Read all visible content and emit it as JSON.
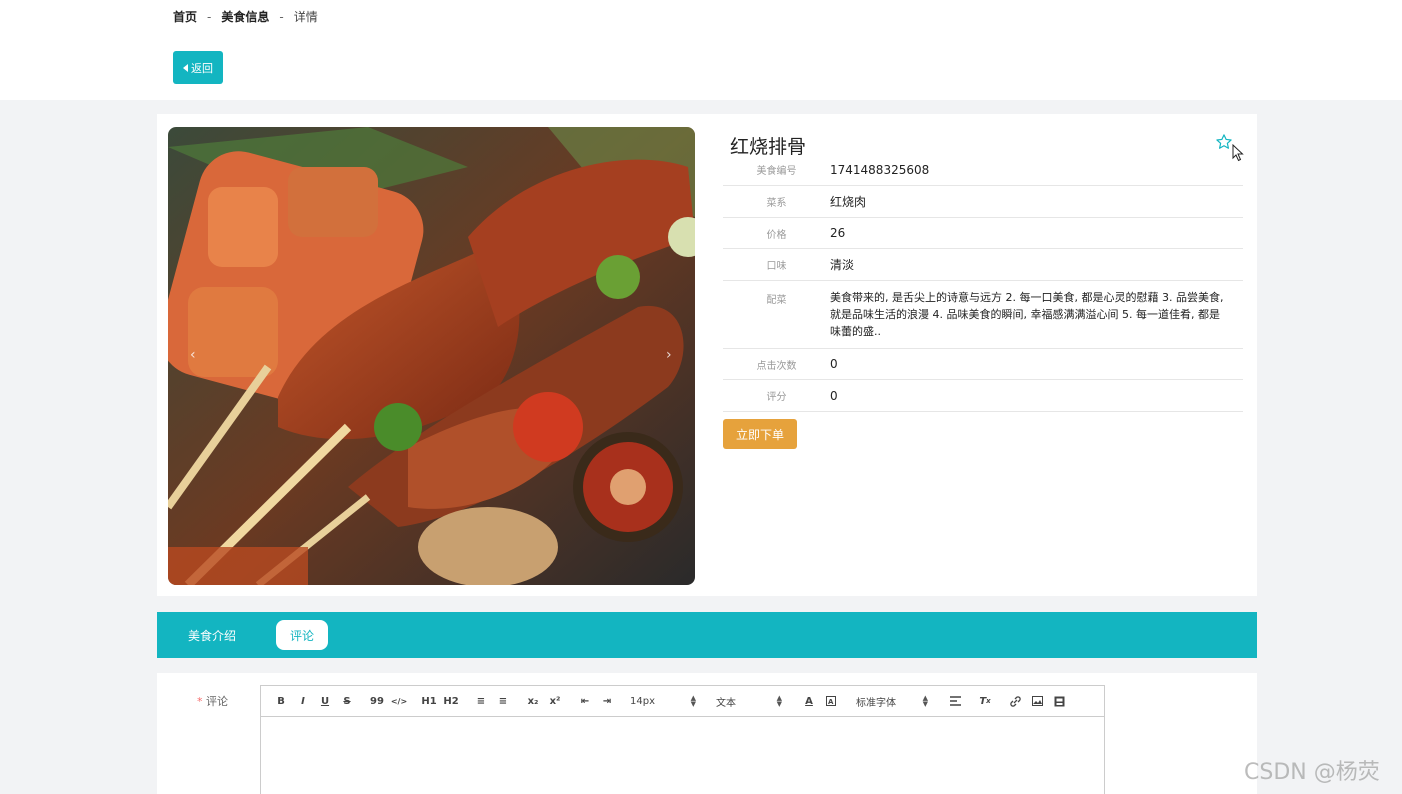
{
  "breadcrumb": {
    "home": "首页",
    "section": "美食信息",
    "current": "详情",
    "separator": "-"
  },
  "back_button": {
    "label": "返回",
    "icon": "caret-left-icon"
  },
  "detail": {
    "title": "红烧排骨",
    "favorite_icon": "star-outline-icon",
    "fields": [
      {
        "label": "美食编号",
        "value": "1741488325608"
      },
      {
        "label": "菜系",
        "value": "红烧肉"
      },
      {
        "label": "价格",
        "value": "26"
      },
      {
        "label": "口味",
        "value": "清淡"
      },
      {
        "label": "配菜",
        "value": "美食带来的, 是舌尖上的诗意与远方 2. 每一口美食, 都是心灵的慰藉 3. 品尝美食, 就是品味生活的浪漫 4. 品味美食的瞬间, 幸福感满满溢心间 5. 每一道佳肴, 都是味蕾的盛.."
      },
      {
        "label": "点击次数",
        "value": "0"
      },
      {
        "label": "评分",
        "value": "0"
      }
    ],
    "order_button": "立即下单",
    "carousel": {
      "prev": "‹",
      "next": "›"
    }
  },
  "tabs": [
    {
      "label": "美食介绍",
      "active": false
    },
    {
      "label": "评论",
      "active": true
    }
  ],
  "comment": {
    "required_mark": "*",
    "label": "评论",
    "toolbar": {
      "buttons": [
        "B",
        "I",
        "U",
        "S",
        "99",
        "</>",
        "H1",
        "H2",
        "≡",
        "≡",
        "x₂",
        "x²",
        "⇤",
        "⇥"
      ],
      "font_size": "14px",
      "text_type": "文本",
      "font_family": "标准字体"
    }
  },
  "watermark": "CSDN @杨荧",
  "colors": {
    "accent": "#13b5c1",
    "order": "#e6a23c",
    "background": "#f2f3f5"
  }
}
